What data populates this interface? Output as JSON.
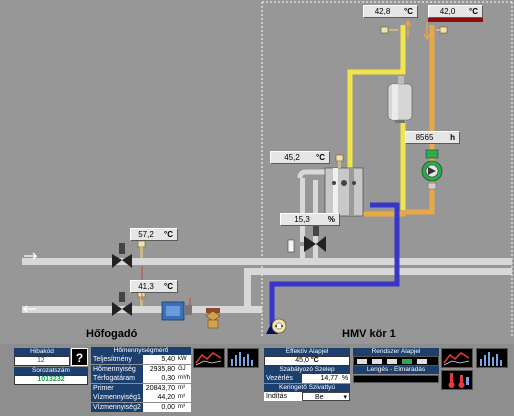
{
  "top_left_temp": {
    "value": "42,8",
    "unit": "°C"
  },
  "top_right_temp": {
    "value": "42,0",
    "unit": "°C"
  },
  "operating_hours": {
    "value": "8565",
    "unit": "h"
  },
  "hmv_temp": {
    "value": "45,2",
    "unit": "°C"
  },
  "valve_position": {
    "value": "15,3",
    "unit": "%"
  },
  "primary_supply_temp": {
    "value": "57,2",
    "unit": "°C"
  },
  "primary_return_temp": {
    "value": "41,3",
    "unit": "°C"
  },
  "titles": {
    "hofogado": "Hőfogadó",
    "hmv_kor": "HMV kör 1"
  },
  "error_panel": {
    "header": "Hibakód",
    "value": "12",
    "help": "?"
  },
  "serial_panel": {
    "header": "Sorozatszám",
    "value": "1013232"
  },
  "heat_meter": {
    "header": "Hőmennyiségmérő",
    "rows": [
      {
        "label": "Teljesítmény",
        "value": "5,40",
        "unit": "kW"
      },
      {
        "label": "Hőmennyiség",
        "value": "2935,80",
        "unit": "GJ"
      },
      {
        "label": "Térfogatáram",
        "value": "0,30",
        "unit": "m³/h"
      },
      {
        "label": "Primer",
        "value": "20843,70",
        "unit": "m³"
      },
      {
        "label": "Vízmennyiség1",
        "value": "44,20",
        "unit": "m³"
      },
      {
        "label": "Vízmennyiség2",
        "value": "0,00",
        "unit": "m³"
      }
    ]
  },
  "effective_setpoint": {
    "header": "Effektív Alapjel",
    "value": "45,0",
    "unit": "°C"
  },
  "controller": {
    "header": "Szabályozó Szelep",
    "label": "Vezérlés",
    "value": "14,77",
    "unit": "%"
  },
  "circulation": {
    "header": "Keringető Szivattyú",
    "label": "Indítás",
    "value": "Be"
  },
  "system_setpoint": {
    "header": "Rendszer Alapjel"
  },
  "oscillation": {
    "header": "Lengés - Elmaradás"
  },
  "colors": {
    "background": "#979797",
    "panel_header": "#1c3f6e",
    "hot_pipe": "#f2e54a",
    "return_pipe": "#e7a845",
    "cold_pipe": "#3636c8",
    "alarm": "#8b0f0f"
  }
}
